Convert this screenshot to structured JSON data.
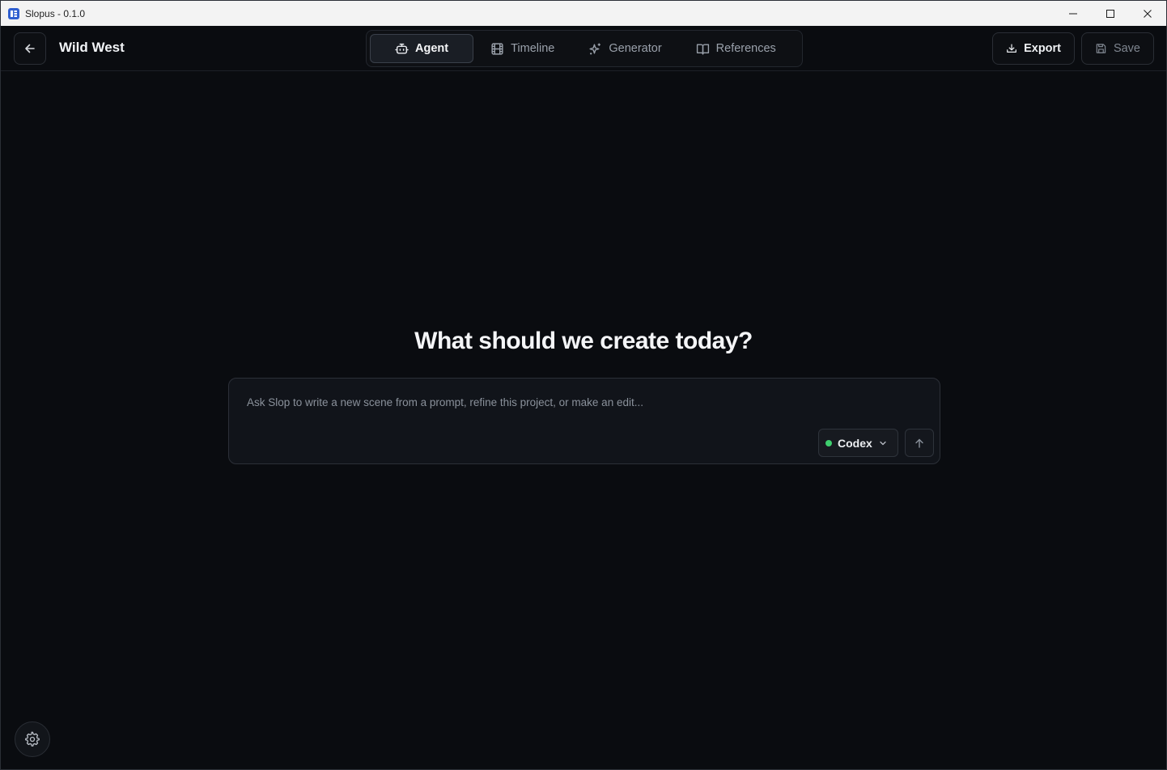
{
  "os_window": {
    "title": "Slopus - 0.1.0",
    "controls": [
      "minimize-icon",
      "maximize-icon",
      "close-icon"
    ]
  },
  "header": {
    "project_title": "Wild West",
    "back_icon": "arrow-left-icon",
    "tabs": [
      {
        "label": "Agent",
        "icon": "bot-icon",
        "active": true
      },
      {
        "label": "Timeline",
        "icon": "film-icon",
        "active": false
      },
      {
        "label": "Generator",
        "icon": "sparkles-icon",
        "active": false
      },
      {
        "label": "References",
        "icon": "book-open-icon",
        "active": false
      }
    ],
    "export_label": "Export",
    "save_label": "Save"
  },
  "main": {
    "headline": "What should we create today?",
    "composer": {
      "placeholder": "Ask Slop to write a new scene from a prompt, refine this project, or make an edit...",
      "value": "",
      "model": "Codex",
      "model_status_color": "#3ecf6e",
      "send_icon": "arrow-up-icon"
    }
  },
  "footer": {
    "settings_icon": "gear-icon"
  },
  "colors": {
    "background": "#0a0c10",
    "surface": "#11141a",
    "border": "#2c3038",
    "text": "#f4f5f7",
    "muted": "#8a919b"
  }
}
